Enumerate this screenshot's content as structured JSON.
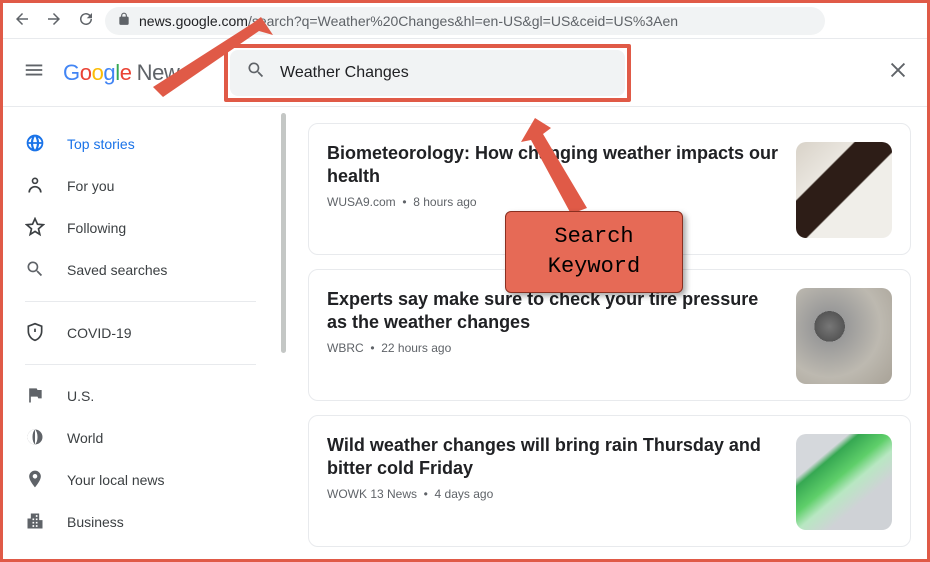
{
  "browser": {
    "url_domain": "news.google.com",
    "url_path": "/search?q=Weather%20Changes&hl=en-US&gl=US&ceid=US%3Aen"
  },
  "header": {
    "product_name": "News",
    "search_value": "Weather Changes"
  },
  "sidebar": {
    "items": [
      {
        "label": "Top stories",
        "active": true,
        "icon": "globe"
      },
      {
        "label": "For you",
        "icon": "person"
      },
      {
        "label": "Following",
        "icon": "star"
      },
      {
        "label": "Saved searches",
        "icon": "search"
      },
      {
        "label": "COVID-19",
        "icon": "shield",
        "divider_above": true
      },
      {
        "label": "U.S.",
        "icon": "flag",
        "divider_above": true
      },
      {
        "label": "World",
        "icon": "world"
      },
      {
        "label": "Your local news",
        "icon": "pin"
      },
      {
        "label": "Business",
        "icon": "business"
      }
    ]
  },
  "results": [
    {
      "title": "Biometeorology: How changing weather impacts our health",
      "source": "WUSA9.com",
      "time": "8 hours ago",
      "thumb": "thumb1"
    },
    {
      "title": "Experts say make sure to check your tire pressure as the weather changes",
      "source": "WBRC",
      "time": "22 hours ago",
      "thumb": "thumb2"
    },
    {
      "title": "Wild weather changes will bring rain Thursday and bitter cold Friday",
      "source": "WOWK 13 News",
      "time": "4 days ago",
      "thumb": "thumb3"
    }
  ],
  "annotation": {
    "line1": "Search",
    "line2": "Keyword"
  }
}
